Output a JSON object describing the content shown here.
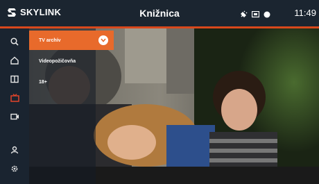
{
  "app": {
    "brand": "SKYLINK",
    "title": "Knižnica",
    "clock": "11:49"
  },
  "sidebar": {
    "items": [
      {
        "icon": "search-icon"
      },
      {
        "icon": "home-icon"
      },
      {
        "icon": "book-icon"
      },
      {
        "icon": "tv-icon",
        "active": true
      },
      {
        "icon": "video-camera-icon"
      },
      {
        "icon": "user-icon"
      },
      {
        "icon": "settings-gear-icon"
      }
    ]
  },
  "menu": {
    "items": [
      {
        "label": "TV archív"
      },
      {
        "label": "Videopožičovňa"
      },
      {
        "label": "18+"
      }
    ]
  },
  "colors": {
    "accent": "#e86a2b",
    "topbar": "#1b2530",
    "sidebar": "#1a2430"
  }
}
